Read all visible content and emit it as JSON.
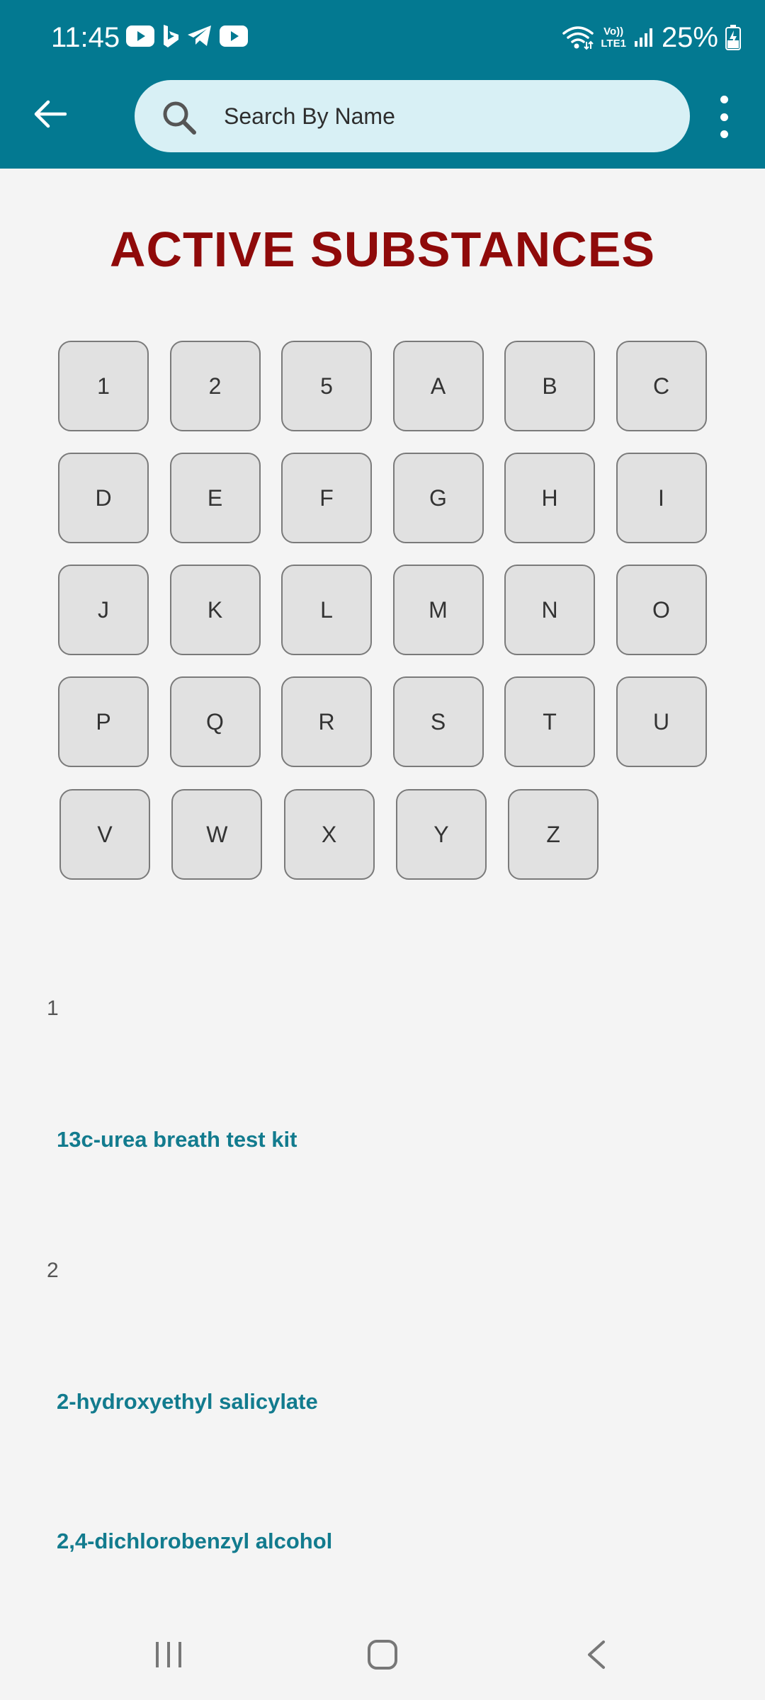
{
  "status_bar": {
    "time": "11:45",
    "volte_top": "Vo))",
    "volte_bottom": "LTE1",
    "battery": "25%"
  },
  "header": {
    "search": {
      "placeholder": "Search By Name",
      "value": ""
    }
  },
  "page": {
    "title": "ACTIVE SUBSTANCES"
  },
  "letters": [
    "1",
    "2",
    "5",
    "A",
    "B",
    "C",
    "D",
    "E",
    "F",
    "G",
    "H",
    "I",
    "J",
    "K",
    "L",
    "M",
    "N",
    "O",
    "P",
    "Q",
    "R",
    "S",
    "T",
    "U",
    "V",
    "W",
    "X",
    "Y",
    "Z"
  ],
  "sections": [
    {
      "header": "1",
      "items": [
        "13c-urea breath test kit"
      ]
    },
    {
      "header": "2",
      "items": [
        "2-hydroxyethyl salicylate",
        "2,4-dichlorobenzyl alcohol"
      ]
    }
  ],
  "colors": {
    "app_bar": "#037991",
    "title": "#8f0a0a",
    "link": "#127b8e",
    "search_bg": "#d8f0f5"
  }
}
